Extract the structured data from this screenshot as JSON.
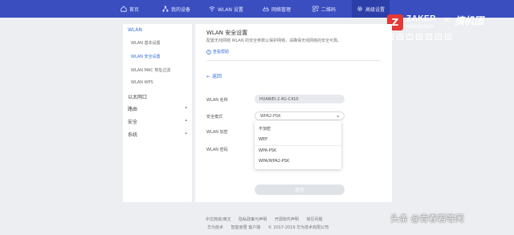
{
  "nav": {
    "items": [
      {
        "icon": "home-icon",
        "label": "首页"
      },
      {
        "icon": "network-icon",
        "label": "我的设备"
      },
      {
        "icon": "wifi-icon",
        "label": "WLAN 设置"
      },
      {
        "icon": "router-icon",
        "label": "网络管理"
      },
      {
        "icon": "qr-icon",
        "label": "二维码"
      },
      {
        "icon": "gear-icon",
        "label": "高级设置"
      }
    ]
  },
  "watermark": {
    "badge": "Z",
    "title": "ZAKER",
    "subtitle": "专属的新闻APP",
    "cross": "×",
    "brand": "搞机团",
    "strip": [
      "新",
      "闻",
      "二",
      "维",
      "码",
      "下",
      "载"
    ]
  },
  "sidebar": {
    "items": [
      {
        "label": "WLAN",
        "active": true,
        "head": true
      },
      {
        "label": "WLAN 基本设置",
        "active": false,
        "head": false
      },
      {
        "label": "WLAN 安全设置",
        "active": true,
        "head": false
      },
      {
        "label": "WLAN MAC 地址过滤",
        "active": false,
        "head": false
      },
      {
        "label": "WLAN WPS",
        "active": false,
        "head": false
      },
      {
        "label": "以太网口",
        "active": false,
        "head": true
      },
      {
        "label": "路由",
        "active": false,
        "head": true,
        "arrow": "▴"
      },
      {
        "label": "安全",
        "active": false,
        "head": true,
        "arrow": "▴"
      },
      {
        "label": "系统",
        "active": false,
        "head": true,
        "arrow": "▴"
      }
    ]
  },
  "panel": {
    "title": "WLAN 安全设置",
    "description": "配置无线网络 WLAN 的安全参数以保护网络，请确保无线网络的安全可靠。",
    "help": "查看帮助",
    "back": "返回",
    "ssid_label": "WLAN 名称",
    "ssid_value": "HUAWEI-2.4G-C410",
    "security_label": "安全模式",
    "security_value": "WPA2-PSK",
    "encryption_label": "WLAN 加密",
    "password_label": "WLAN 密码",
    "save": "保存"
  },
  "dropdown": {
    "options": [
      "不加密",
      "WEP",
      "WPA-PSK",
      "WPA/WPA2-PSK"
    ]
  },
  "footer": {
    "row1": [
      "中文简体/英文",
      "隐私政策与声明",
      "开源软件声明",
      "常见问题"
    ],
    "row2": [
      "华为技术",
      "智能家居 客户端",
      "© 2017-2019 华为技术有限公司"
    ]
  },
  "credit": "头条 @青春若等闲"
}
